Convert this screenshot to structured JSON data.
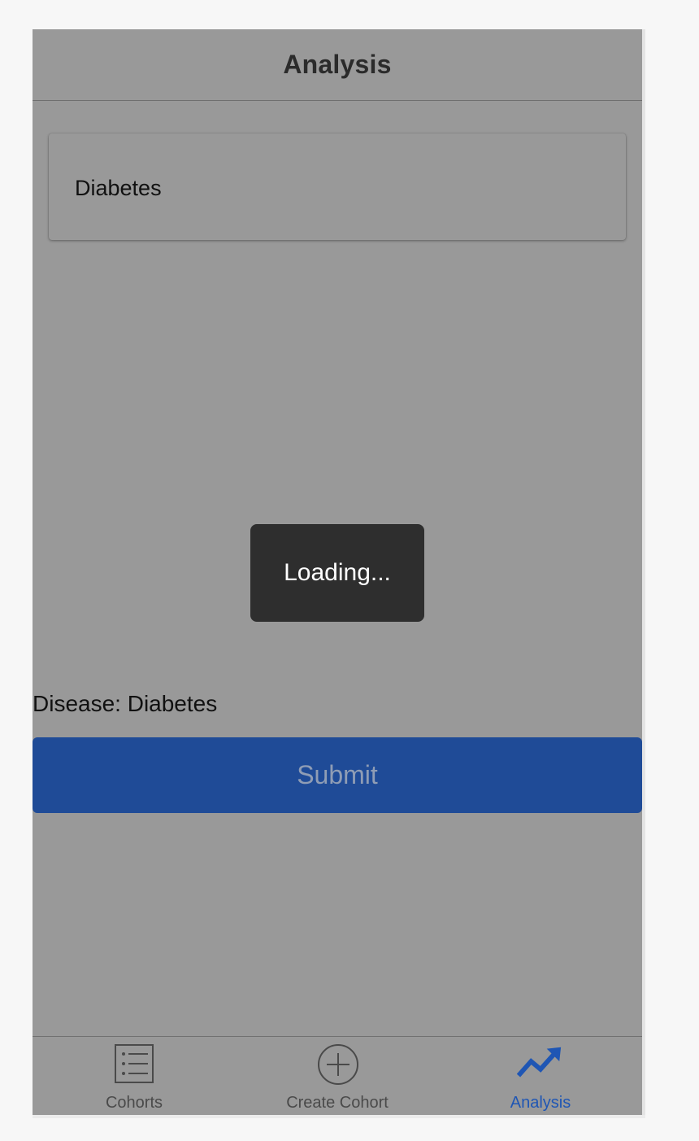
{
  "header": {
    "title": "Analysis"
  },
  "card": {
    "label": "Diabetes"
  },
  "loading": {
    "text": "Loading..."
  },
  "form": {
    "disease_line": "Disease: Diabetes",
    "submit_label": "Submit"
  },
  "tabs": [
    {
      "label": "Cohorts",
      "icon": "list-icon",
      "active": false
    },
    {
      "label": "Create Cohort",
      "icon": "plus-circle-icon",
      "active": false
    },
    {
      "label": "Analysis",
      "icon": "trending-up-icon",
      "active": true
    }
  ],
  "colors": {
    "accent": "#1f56b4",
    "submit_background": "#1f4b97",
    "overlay_background": "#999999",
    "toast_background": "#2e2e2e"
  }
}
